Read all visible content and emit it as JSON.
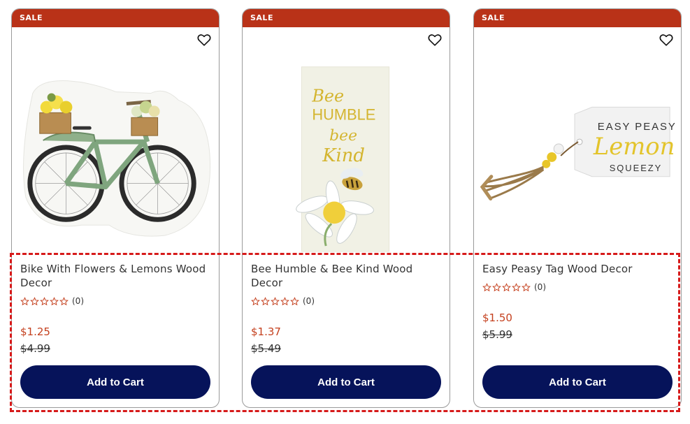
{
  "products": [
    {
      "badge": "SALE",
      "title": "Bike With Flowers & Lemons Wood Decor",
      "rating_count": "(0)",
      "sale_price": "$1.25",
      "original_price": "$4.99",
      "cart_label": "Add to Cart"
    },
    {
      "badge": "SALE",
      "title": "Bee Humble & Bee Kind Wood Decor",
      "rating_count": "(0)",
      "sale_price": "$1.37",
      "original_price": "$5.49",
      "cart_label": "Add to Cart"
    },
    {
      "badge": "SALE",
      "title": "Easy Peasy Tag Wood Decor",
      "rating_count": "(0)",
      "sale_price": "$1.50",
      "original_price": "$5.99",
      "cart_label": "Add to Cart"
    }
  ],
  "image_text": {
    "bee_line1": "Bee",
    "bee_line2": "HUMBLE",
    "bee_line3": "bee",
    "bee_line4": "Kind",
    "tag_line1": "EASY PEASY",
    "tag_line2": "Lemon",
    "tag_line3": "SQUEEZY"
  },
  "colors": {
    "sale_band": "#b93218",
    "sale_price": "#c4401e",
    "button": "#06135a",
    "highlight": "#d61a1a"
  },
  "icons": [
    "heart-icon",
    "star-outline-icon"
  ]
}
